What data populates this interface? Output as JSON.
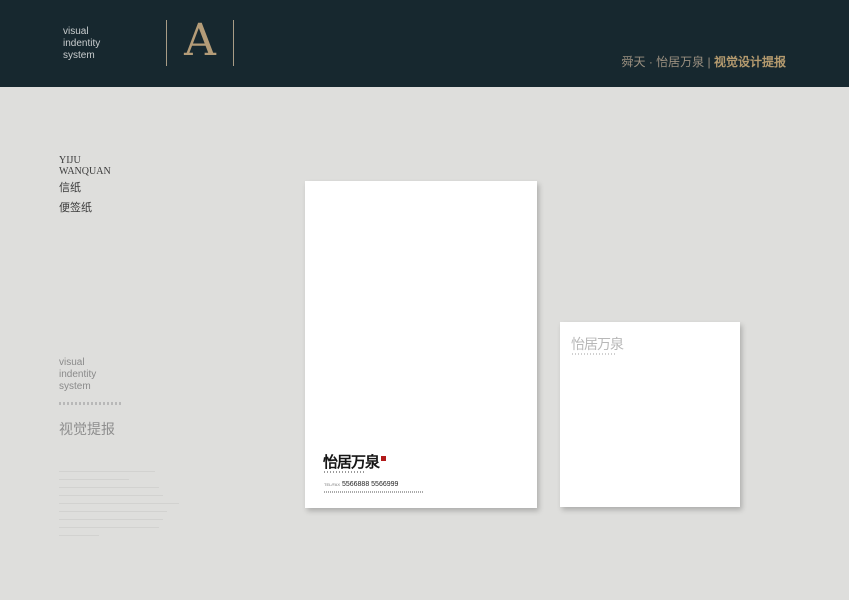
{
  "header": {
    "vis_lines": [
      "visual",
      "indentity",
      "system"
    ],
    "letter": "A",
    "title_normal": "舜天 · 怡居万泉",
    "title_sep": "|",
    "title_bold": "视觉设计提报"
  },
  "sidebar": {
    "name_lines": [
      "YIJU",
      "WANQUAN"
    ],
    "items": [
      "信纸",
      "便签纸"
    ],
    "vis_lines": [
      "visual",
      "indentity",
      "system"
    ],
    "cn_title": "视觉提报"
  },
  "letterhead": {
    "logo": "怡居万泉",
    "phone_label": "TEL/FAX",
    "phone": "5566888  5566999"
  },
  "memo": {
    "logo": "怡居万泉"
  },
  "colors": {
    "header_bg": "#17282f",
    "accent_gold": "#b49c78",
    "page_bg": "#dededc",
    "seal_red": "#b11a1a"
  }
}
